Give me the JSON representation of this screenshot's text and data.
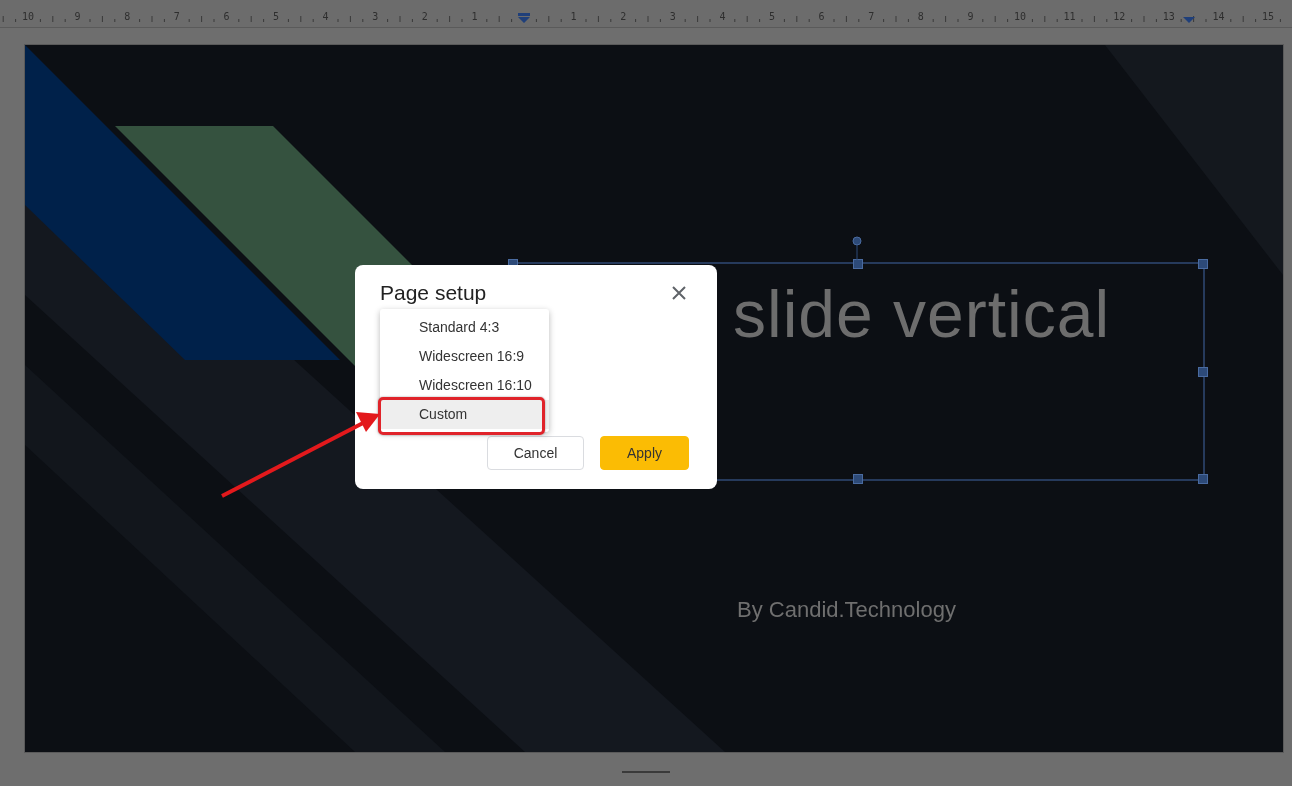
{
  "ruler": {
    "left_labels": [
      "10",
      "9",
      "8",
      "7",
      "6",
      "5",
      "4",
      "3",
      "2",
      "1"
    ],
    "right_labels": [
      "1",
      "2",
      "3",
      "4",
      "5",
      "6",
      "7",
      "8",
      "9",
      "10",
      "11",
      "12",
      "13",
      "14",
      "15"
    ]
  },
  "slide": {
    "title": "slide vertical",
    "subtitle": "By Candid.Technology"
  },
  "dialog": {
    "title": "Page setup",
    "buttons": [
      {
        "label": "Cancel",
        "kind": "secondary"
      },
      {
        "label": "Apply",
        "kind": "primary"
      }
    ]
  },
  "menu": {
    "items": [
      {
        "label": "Standard 4:3",
        "selected": false
      },
      {
        "label": "Widescreen 16:9",
        "selected": false
      },
      {
        "label": "Widescreen 16:10",
        "selected": false
      },
      {
        "label": "Custom",
        "selected": true
      }
    ]
  }
}
